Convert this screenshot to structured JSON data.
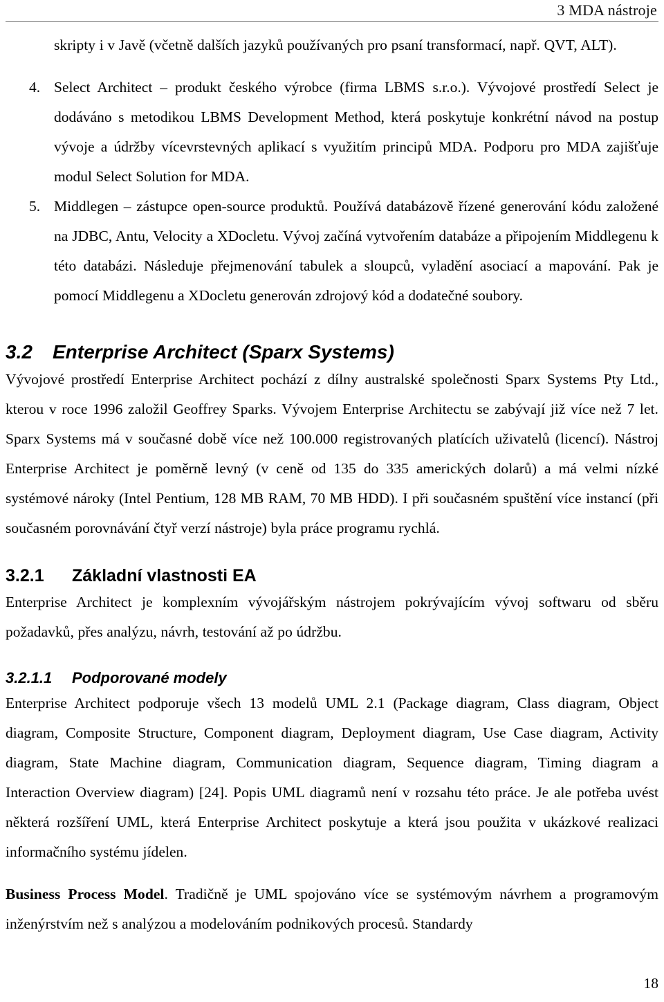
{
  "document": {
    "language": "cs",
    "page_number": "18"
  },
  "header": {
    "title": "3 MDA nástroje"
  },
  "intro_paragraph": {
    "text": "skripty i v Javě (včetně dalších jazyků používaných pro psaní transformací, např. QVT, ALT)."
  },
  "numbered_list": {
    "items": [
      {
        "marker": "4.",
        "text": "Select Architect – produkt českého výrobce (firma LBMS s.r.o.). Vývojové prostředí Select je dodáváno s metodikou LBMS Development Method, která poskytuje konkrétní návod na postup vývoje a údržby vícevrstevných aplikací s využitím principů MDA. Podporu pro MDA zajišťuje modul Select Solution for MDA."
      },
      {
        "marker": "5.",
        "text": "Middlegen – zástupce open-source produktů. Používá databázově řízené generování kódu založené na JDBC, Antu, Velocity a XDocletu. Vývoj začíná vytvořením databáze a připojením Middlegenu k této databázi. Následuje přejmenování tabulek a sloupců, vyladění asociací a mapování. Pak je pomocí Middlegenu a XDocletu generován zdrojový kód a dodatečné soubory."
      }
    ]
  },
  "section_3_2": {
    "number": "3.2",
    "title": "Enterprise Architect (Sparx Systems)",
    "paragraph": "Vývojové prostředí Enterprise Architect pochází z dílny australské společnosti Sparx Systems Pty Ltd., kterou v roce 1996 založil Geoffrey Sparks. Vývojem Enterprise Architectu se zabývají již více než 7 let. Sparx Systems má v současné době více než 100.000 registrovaných platících uživatelů (licencí). Nástroj Enterprise Architect je poměrně levný (v ceně od 135 do 335 amerických dolarů) a má velmi nízké systémové nároky (Intel Pentium, 128 MB RAM, 70 MB HDD). I při současném spuštění více instancí (při současném porovnávání čtyř verzí nástroje) byla práce programu rychlá."
  },
  "section_3_2_1": {
    "number": "3.2.1",
    "title": "Základní vlastnosti EA",
    "paragraph": "Enterprise Architect je komplexním vývojářským nástrojem pokrývajícím vývoj softwaru od sběru požadavků, přes analýzu, návrh, testování až po údržbu."
  },
  "section_3_2_1_1": {
    "number": "3.2.1.1",
    "title": "Podporované modely",
    "paragraph": "Enterprise Architect podporuje všech 13 modelů UML 2.1 (Package diagram, Class diagram, Object diagram, Composite Structure, Component diagram, Deployment diagram, Use Case diagram, Activity diagram, State Machine diagram, Communication diagram, Sequence diagram, Timing diagram a Interaction Overview diagram) [24]. Popis UML diagramů není v rozsahu této práce. Je ale potřeba uvést některá rozšíření UML, která Enterprise Architect poskytuje a která jsou použita v ukázkové realizaci informačního systému jídelen.",
    "last_paragraph_bold_lead": "Business Process Model",
    "last_paragraph_rest": ". Tradičně je UML spojováno více se systémovým návrhem a programovým inženýrstvím než s analýzou a modelováním podnikových procesů. Standardy"
  }
}
